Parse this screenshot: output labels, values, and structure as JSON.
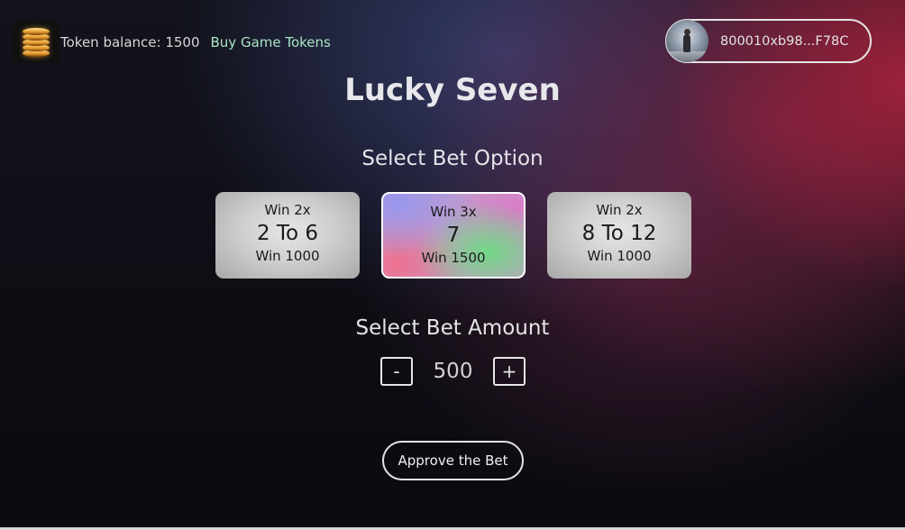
{
  "header": {
    "token_icon": "gold-coin-stack-icon",
    "token_balance_label": "Token balance: 1500",
    "buy_link": "Buy Game Tokens",
    "wallet_address": "800010xb98...F78C",
    "avatar_icon": "user-avatar"
  },
  "game": {
    "title": "Lucky Seven"
  },
  "bet_option": {
    "heading": "Select Bet Option",
    "options": [
      {
        "top": "Win 2x",
        "main": "2 To 6",
        "bottom": "Win 1000",
        "selected": false
      },
      {
        "top": "Win 3x",
        "main": "7",
        "bottom": "Win 1500",
        "selected": true
      },
      {
        "top": "Win 2x",
        "main": "8 To 12",
        "bottom": "Win 1000",
        "selected": false
      }
    ]
  },
  "bet_amount": {
    "heading": "Select Bet Amount",
    "decrement": "-",
    "value": "500",
    "increment": "+"
  },
  "actions": {
    "approve": "Approve the Bet"
  },
  "colors": {
    "link": "#a9e5c2",
    "text": "#ffffff",
    "border": "#e4e4e4"
  }
}
